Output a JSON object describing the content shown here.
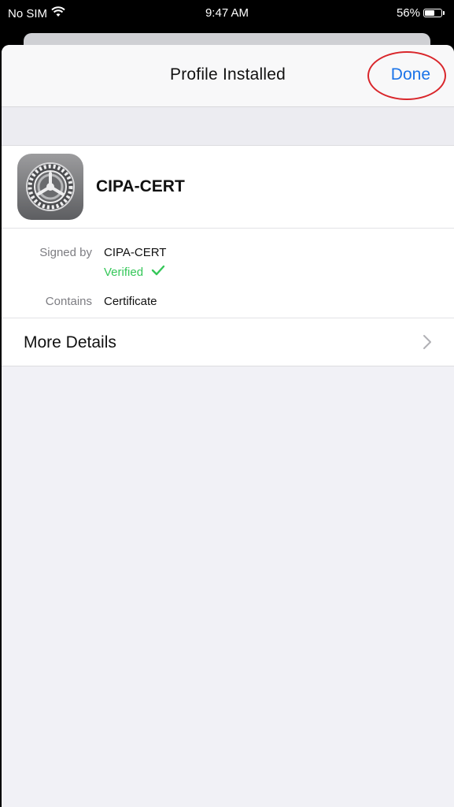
{
  "status_bar": {
    "carrier": "No SIM",
    "time": "9:47 AM",
    "battery": "56%",
    "battery_level": 0.56,
    "wifi_icon": "wifi-icon"
  },
  "nav": {
    "title": "Profile Installed",
    "done_label": "Done",
    "highlight_color": "#d9262b",
    "accent_color": "#1a73e8"
  },
  "profile": {
    "name": "CIPA-CERT",
    "icon": "settings-gear-icon"
  },
  "details": {
    "signed_by_label": "Signed by",
    "signed_by_value": "CIPA-CERT",
    "verified_label": "Verified",
    "verified_color": "#35c759",
    "contains_label": "Contains",
    "contains_value": "Certificate"
  },
  "more_details": {
    "label": "More Details"
  }
}
